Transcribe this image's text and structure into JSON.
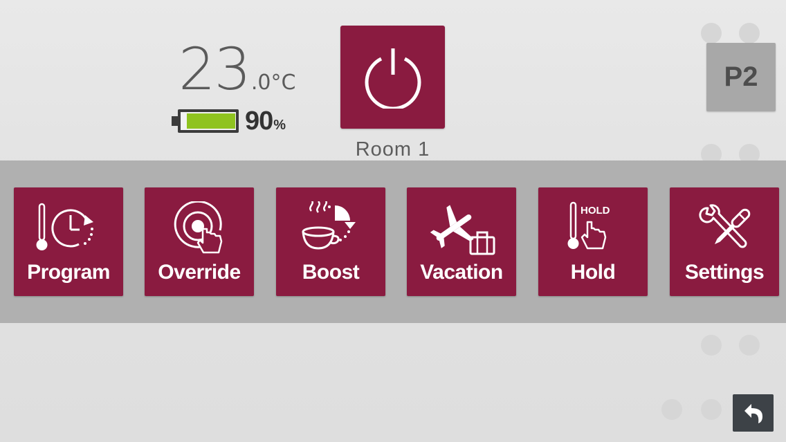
{
  "status": {
    "temperature_whole": "23",
    "temperature_decimal_unit": ".0°C",
    "battery_percent_value": "90",
    "battery_percent_sign": "%",
    "battery_level": 0.9
  },
  "zone": {
    "room_label": "Room 1",
    "power_icon": "power-icon",
    "profile_label": "P2"
  },
  "menu": {
    "tiles": [
      {
        "label": "Program",
        "icon": "program-icon"
      },
      {
        "label": "Override",
        "icon": "override-icon"
      },
      {
        "label": "Boost",
        "icon": "boost-icon"
      },
      {
        "label": "Vacation",
        "icon": "vacation-icon"
      },
      {
        "label": "Hold",
        "icon": "hold-icon",
        "icon_text": "HOLD"
      },
      {
        "label": "Settings",
        "icon": "settings-icon"
      }
    ]
  },
  "nav": {
    "back_icon": "back-arrow-icon"
  },
  "colors": {
    "tile": "#8a1b40",
    "band": "#b0b0b0",
    "battery_fill": "#8fc31f",
    "profile_button": "#a8a8a8",
    "back_button": "#3d4247"
  }
}
